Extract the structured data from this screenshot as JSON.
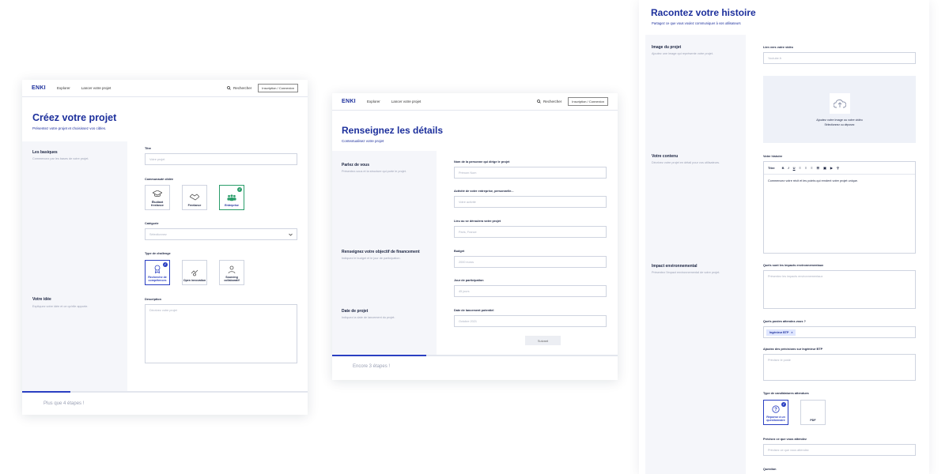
{
  "screen1": {
    "nav": {
      "logo": "ENKI",
      "explore": "Explorer",
      "launch": "Lancer votre projet",
      "search": "Rechercher",
      "auth": "Inscription / Connexion"
    },
    "title": "Créez votre projet",
    "subtitle": "Présentez votre projet et choisissez vos cibles.",
    "basics_title": "Les basiques",
    "basics_desc": "Commencez par les bases de votre projet.",
    "idea_title": "Votre idée",
    "idea_desc": "Expliquez votre idée et ce qu'elle apporte.",
    "fields": {
      "titre_label": "Titre",
      "titre_placeholder": "Votre projet",
      "community_label": "Communauté ciblée",
      "category_label": "Catégorie",
      "category_placeholder": "Sélectionnez",
      "challenge_label": "Type de challenge",
      "description_label": "Description",
      "description_placeholder": "Décrivez votre projet"
    },
    "communities": [
      {
        "label": "Étudiant freelance",
        "icon": "graduation-cap-icon"
      },
      {
        "label": "Freelance",
        "icon": "handshake-icon"
      },
      {
        "label": "Entreprise",
        "icon": "team-icon"
      }
    ],
    "challenges": [
      {
        "label": "Recherche de compétences",
        "icon": "award-icon"
      },
      {
        "label": "Open innovation",
        "icon": "lightbulb-icon"
      },
      {
        "label": "Sourcing collaboratif",
        "icon": "people-icon"
      }
    ],
    "footer": "Plus que 4 étapes !",
    "progress": 0.17
  },
  "screen2": {
    "nav": {
      "logo": "ENKI",
      "explore": "Explorer",
      "launch": "Lancer votre projet",
      "search": "Rechercher",
      "auth": "Inscription / Connexion"
    },
    "title": "Renseignez les détails",
    "subtitle": "Contextualisez votre projet",
    "sections": [
      {
        "title": "Parlez de vous",
        "desc": "Présentez-vous et la structure qui porte le projet."
      },
      {
        "title": "Renseignez votre objectif de financement",
        "desc": "Indiquez le budget et le jour de participation."
      },
      {
        "title": "Date de projet",
        "desc": "Indiquez la date de lancement du projet."
      }
    ],
    "fields": [
      {
        "label": "Nom de la personne qui dirige le projet",
        "placeholder": "Prénom Nom"
      },
      {
        "label": "Activité de votre entreprise, personnelle...",
        "placeholder": "Votre activité"
      },
      {
        "label": "Lieu ou se déroulera votre projet",
        "placeholder": "Paris, France"
      },
      {
        "label": "Budget",
        "placeholder": "2000 euros"
      },
      {
        "label": "Jour de participation",
        "placeholder": "45 jours"
      },
      {
        "label": "Date de lancement potentiel",
        "placeholder": "Octobre 2021"
      }
    ],
    "button": "Suivant",
    "footer": "Encore 3 étapes !",
    "progress": 0.33
  },
  "screen3": {
    "title": "Racontez votre histoire",
    "subtitle": "Partagez ce que vous voulez communiquer à vos utilisateurs",
    "sections": [
      {
        "title": "Image du projet",
        "desc": "Ajoutez une image qui représente votre projet."
      },
      {
        "title": "Votre contenu",
        "desc": "Décrivez votre projet en détail pour vos utilisateurs."
      },
      {
        "title": "Impact environnemental",
        "desc": "Présentez l'impact environnemental de votre projet."
      }
    ],
    "video_label": "Lien vers votre vidéo",
    "video_placeholder": "Youtube.fr",
    "upload_text": "Ajoutez votre image ou votre vidéo",
    "upload_sub": "Sélectionnez ou déposez",
    "story_label": "Votre histoire",
    "toolbar_title": "Titre",
    "story_text": "Commencez votre récit et les points qui rendent votre projet unique.",
    "impact_label": "Quels sont les impacts environnementaux",
    "impact_placeholder": "Présentez les impacts environnementaux",
    "posts_label": "Quels postes attendez-vous ?",
    "tag": "Ingénieur BTP",
    "precision_label": "Ajoutez des précisions sur Ingénieur BTP",
    "precision_placeholder": "Précisez le poste",
    "candidatures_label": "Type de candidatures attendues",
    "cand_tiles": [
      {
        "label": "Réponse à un questionnaire",
        "icon": "question-icon"
      },
      {
        "label": "PDF",
        "icon": "pdf-icon"
      }
    ],
    "expected_label": "Précisez ce que vous attendez",
    "expected_placeholder": "Précisez ce que vous attendez",
    "question_label": "Question"
  }
}
